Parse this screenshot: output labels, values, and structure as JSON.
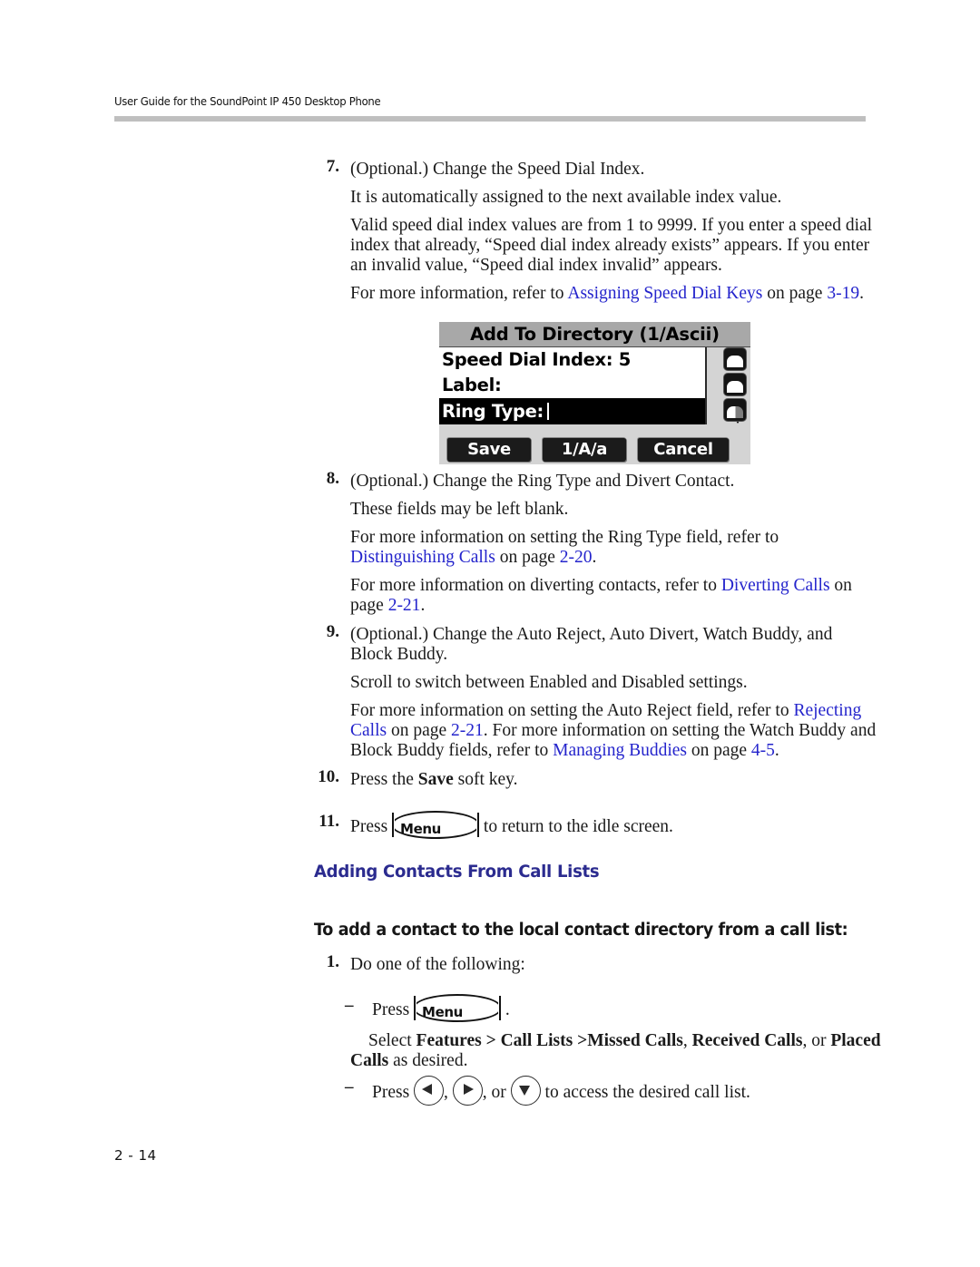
{
  "header": {
    "running_head": "User Guide for the SoundPoint IP 450 Desktop Phone"
  },
  "footer": {
    "page_number": "2 - 14"
  },
  "colors": {
    "link": "#2424cc",
    "heading": "#2b2b8f",
    "rule": "#bfbfbf",
    "lcd_title_bg": "#a8a8a8",
    "lcd_bezel": "#d4d4d4"
  },
  "steps": [
    {
      "number": "7.",
      "lines": [
        "(Optional.) Change the Speed Dial Index.",
        "It is automatically assigned to the next available index value."
      ],
      "paragraph_a": "Valid speed dial index values are from 1 to 9999. If you enter a speed dial",
      "paragraph_b": "index that already, “Speed dial index already exists” appears. If you enter",
      "paragraph_c": "an invalid value, “Speed dial index invalid” appears.",
      "xref_lead": "For more information, refer to ",
      "xref_link": "Assigning Speed Dial Keys",
      "xref_mid": " on page ",
      "xref_page": "3-19",
      "xref_end": "."
    },
    {
      "number": "8.",
      "line1": "(Optional.) Change the Ring Type and Divert Contact.",
      "line2": "These fields may be left blank.",
      "para2_a": "For more information on setting the Ring Type field, refer to",
      "para2_link": "Distinguishing Calls",
      "para2_mid": " on page ",
      "para2_page": "2-20",
      "para2_end": ".",
      "para3_a": "For more information on diverting contacts, refer to ",
      "para3_link": "Diverting Calls",
      "para3_b": " on",
      "para3_c": "page ",
      "para3_page": "2-21",
      "para3_end": "."
    },
    {
      "number": "9.",
      "line1": "(Optional.) Change the Auto Reject, Auto Divert, Watch Buddy, and",
      "line2": "Block Buddy.",
      "line3": "Scroll to switch between Enabled and Disabled settings.",
      "para_a": "For more information on setting the Auto Reject field, refer to ",
      "link1": "Rejecting",
      "link1b": "Calls",
      "para_b": " on page ",
      "page1": "2-21",
      "para_c": ". For more information on setting the Watch Buddy and",
      "para_d": "Block Buddy fields, refer to ",
      "link2": "Managing Buddies",
      "para_e": " on page ",
      "page2": "4-5",
      "para_f": "."
    },
    {
      "number": "10.",
      "pre": "Press the ",
      "bold": "Save",
      "post": " soft key."
    },
    {
      "number": "11.",
      "pre": "Press ",
      "key_label": "Menu",
      "post": " to return to the idle screen."
    }
  ],
  "phone_screen": {
    "title": "Add To Directory (1/Ascii)",
    "rows": [
      {
        "label": "Speed Dial Index: 5",
        "selected": false
      },
      {
        "label": "Label:",
        "selected": false
      },
      {
        "label": "Ring Type:",
        "selected": true
      }
    ],
    "soft_keys": [
      "Save",
      "1/A/a",
      "Cancel"
    ],
    "scroll_up_icon": "arrow-up-icon",
    "scroll_down_icon": "arrow-down-icon",
    "line_icons": [
      "line-key-icon",
      "line-key-icon",
      "line-key-icon"
    ]
  },
  "section": {
    "heading": "Adding Contacts From Call Lists",
    "subheading": "To add a contact to the local contact directory from a call list:",
    "step1_number": "1.",
    "step1_text": "Do one of the following:",
    "bullet1": {
      "dash": "–",
      "pre": "Press ",
      "key_label": "Menu",
      "post": " ."
    },
    "select_line": {
      "a": "Select ",
      "b": "Features > Call Lists >",
      "c": "Missed Calls",
      "d": ", ",
      "e": "Received Calls",
      "f": ", or ",
      "g": "Placed",
      "h": "Calls",
      "i": " as desired."
    },
    "bullet2": {
      "dash": "–",
      "pre": "Press ",
      "sep1": ", ",
      "sep2": ", or ",
      "post": " to access the desired call list.",
      "keys": [
        "nav-left-icon",
        "nav-right-icon",
        "nav-down-icon"
      ]
    }
  }
}
